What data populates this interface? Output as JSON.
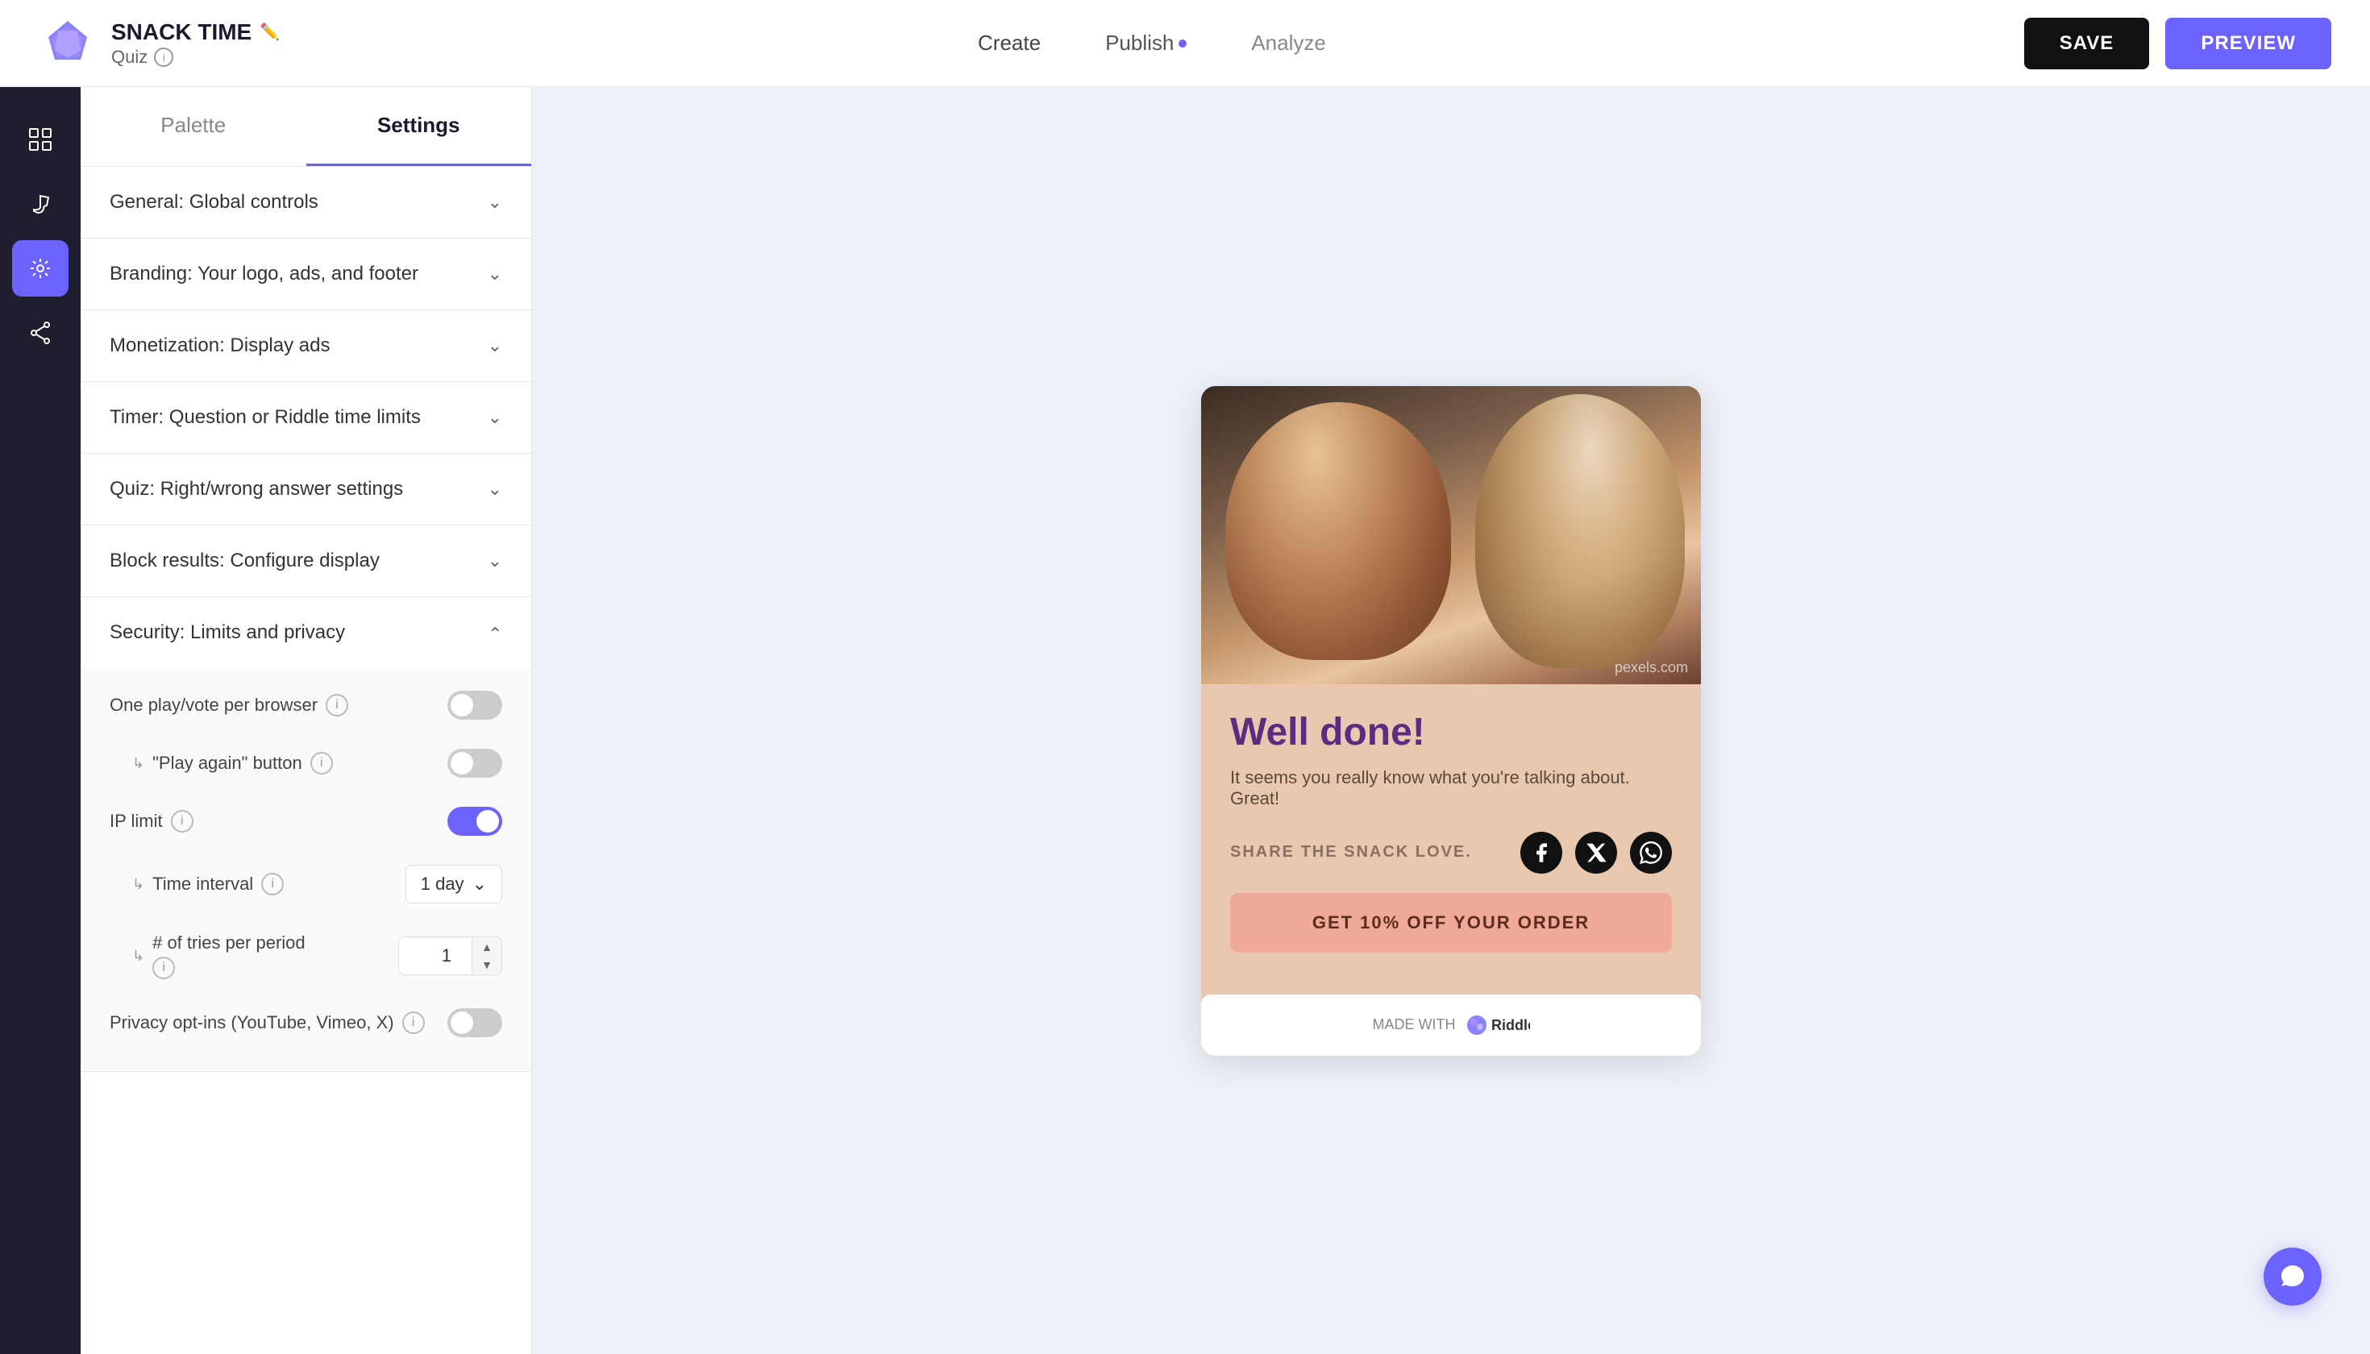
{
  "header": {
    "project_name": "SNACK TIME",
    "project_type": "Quiz",
    "nav": {
      "create_label": "Create",
      "publish_label": "Publish",
      "publish_dot": true,
      "analyze_label": "Analyze"
    },
    "save_label": "SAVE",
    "preview_label": "PREVIEW"
  },
  "sidebar": {
    "items": [
      {
        "id": "grid",
        "label": "grid-icon",
        "active": false
      },
      {
        "id": "settings",
        "label": "settings-icon",
        "active": true
      },
      {
        "id": "share",
        "label": "share-icon",
        "active": false
      }
    ]
  },
  "settings_panel": {
    "tab_palette": "Palette",
    "tab_settings": "Settings",
    "active_tab": "settings",
    "sections": [
      {
        "id": "general",
        "label": "General: Global controls",
        "open": false
      },
      {
        "id": "branding",
        "label": "Branding: Your logo, ads, and footer",
        "open": false
      },
      {
        "id": "monetization",
        "label": "Monetization: Display ads",
        "open": false
      },
      {
        "id": "timer",
        "label": "Timer: Question or Riddle time limits",
        "open": false
      },
      {
        "id": "quiz",
        "label": "Quiz: Right/wrong answer settings",
        "open": false
      },
      {
        "id": "block_results",
        "label": "Block results: Configure display",
        "open": false
      },
      {
        "id": "security",
        "label": "Security: Limits and privacy",
        "open": true
      }
    ],
    "security": {
      "one_play_label": "One play/vote per browser",
      "one_play_value": false,
      "play_again_label": "\"Play again\" button",
      "play_again_value": false,
      "ip_limit_label": "IP limit",
      "ip_limit_value": true,
      "time_interval_label": "Time interval",
      "time_interval_value": "1 day",
      "tries_label": "# of tries per period",
      "tries_value": "1",
      "privacy_label": "Privacy opt-ins (YouTube, Vimeo, X)",
      "privacy_value": false
    }
  },
  "preview": {
    "result_title": "Well done!",
    "result_desc": "It seems you really know what you're talking about. Great!",
    "share_text": "SHARE THE SNACK LOVE.",
    "cta_label": "GET 10% OFF YOUR ORDER",
    "riddle_label": "MADE WITH",
    "pexels_credit": "pexels.com"
  }
}
